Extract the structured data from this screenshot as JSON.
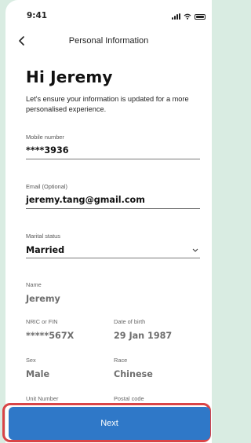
{
  "status_bar": {
    "time": "9:41"
  },
  "nav": {
    "title": "Personal Information"
  },
  "greeting": "Hi Jeremy",
  "subtitle": "Let's ensure your information is updated for a more personalised experience.",
  "fields": {
    "mobile": {
      "label": "Mobile number",
      "value": "****3936"
    },
    "email": {
      "label": "Email (Optional)",
      "value": "jeremy.tang@gmail.com"
    },
    "marital": {
      "label": "Marital status",
      "value": "Married"
    }
  },
  "readonly": {
    "name": {
      "label": "Name",
      "value": "Jeremy"
    },
    "nric": {
      "label": "NRIC or FIN",
      "value": "*****567X"
    },
    "dob": {
      "label": "Date of birth",
      "value": "29 Jan 1987"
    },
    "sex": {
      "label": "Sex",
      "value": "Male"
    },
    "race": {
      "label": "Race",
      "value": "Chinese"
    },
    "unit": {
      "label": "Unit Number"
    },
    "postal": {
      "label": "Postal code"
    }
  },
  "button": {
    "next_label": "Next"
  },
  "colors": {
    "accent": "#2f78c8",
    "highlight_outline": "#d94447",
    "page_bg": "#d9ece2"
  }
}
